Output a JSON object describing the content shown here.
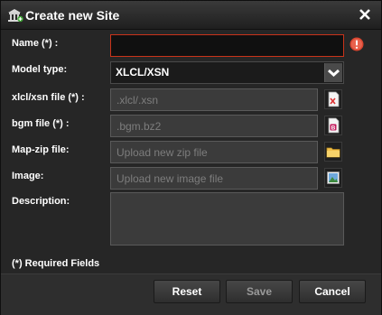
{
  "dialog": {
    "title": "Create new Site",
    "title_icon": "building-add-icon",
    "close_icon": "close-icon"
  },
  "form": {
    "name": {
      "label": "Name (*) :",
      "value": "",
      "error_icon": "error-icon"
    },
    "model_type": {
      "label": "Model type:",
      "value": "XLCL/XSN",
      "dropdown_icon": "chevron-down-icon"
    },
    "xlcl_file": {
      "label": "xlcl/xsn file (*) :",
      "placeholder": ".xlcl/.xsn",
      "icon": "xlcl-file-icon"
    },
    "bgm_file": {
      "label": "bgm file (*) :",
      "placeholder": ".bgm.bz2",
      "icon": "bgm-file-icon"
    },
    "map_zip": {
      "label": "Map-zip file:",
      "placeholder": "Upload new zip file",
      "icon": "folder-icon"
    },
    "image": {
      "label": "Image:",
      "placeholder": "Upload new image file",
      "icon": "image-icon"
    },
    "description": {
      "label": "Description:",
      "value": ""
    }
  },
  "footer": {
    "required_note": "(*) Required Fields",
    "reset_label": "Reset",
    "save_label": "Save",
    "cancel_label": "Cancel"
  },
  "colors": {
    "dialog_bg": "#262626",
    "input_bg": "#3b3b3b",
    "error_border": "#c9331a",
    "error_icon": "#d9452f"
  }
}
